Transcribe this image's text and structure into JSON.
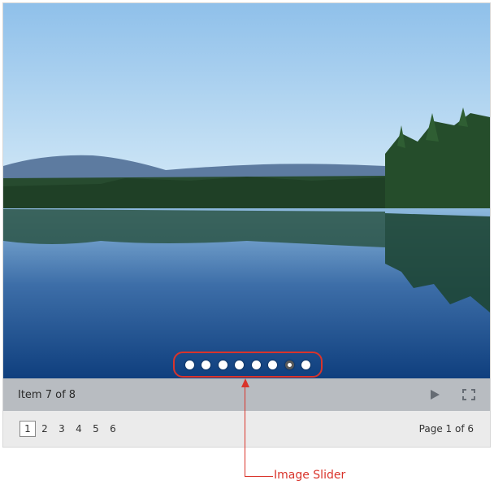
{
  "slider": {
    "dot_count": 8,
    "active_index": 6,
    "status_text": "Item 7 of 8"
  },
  "pager": {
    "pages": [
      "1",
      "2",
      "3",
      "4",
      "5",
      "6"
    ],
    "current_page": "1",
    "info": "Page 1 of 6"
  },
  "icons": {
    "play": "play-icon",
    "fullscreen": "fullscreen-icon"
  },
  "callout": {
    "label": "Image Slider",
    "color": "#d9342b"
  }
}
